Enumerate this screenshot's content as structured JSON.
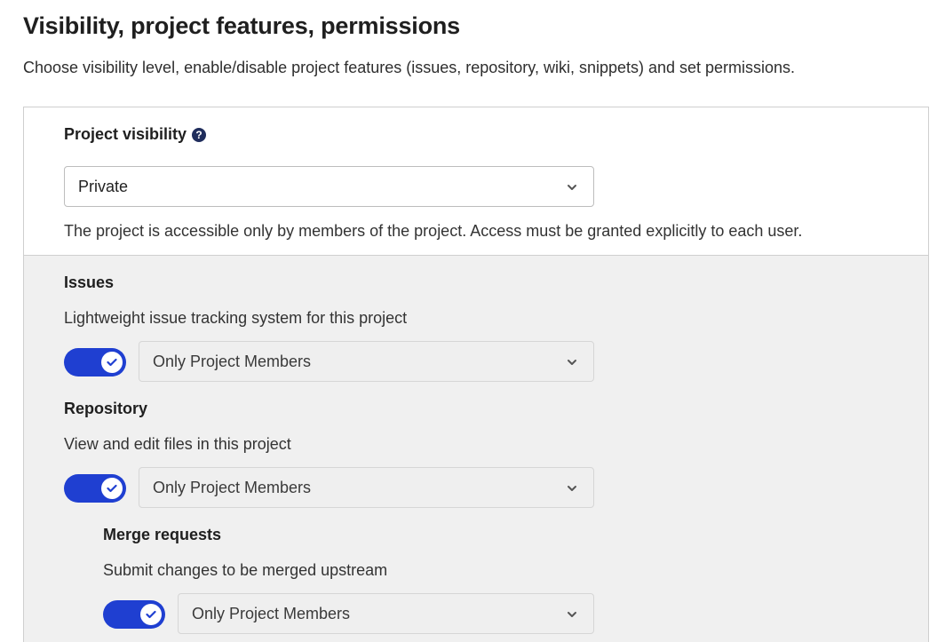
{
  "header": {
    "title": "Visibility, project features, permissions",
    "description": "Choose visibility level, enable/disable project features (issues, repository, wiki, snippets) and set permissions."
  },
  "visibility": {
    "label": "Project visibility",
    "help_icon": "question-circle-icon",
    "help_glyph": "?",
    "selected": "Private",
    "help_text": "The project is accessible only by members of the project. Access must be granted explicitly to each user."
  },
  "features": [
    {
      "name": "Issues",
      "description": "Lightweight issue tracking system for this project",
      "enabled": true,
      "access_level": "Only Project Members"
    },
    {
      "name": "Repository",
      "description": "View and edit files in this project",
      "enabled": true,
      "access_level": "Only Project Members"
    },
    {
      "name": "Merge requests",
      "description": "Submit changes to be merged upstream",
      "enabled": true,
      "access_level": "Only Project Members"
    }
  ],
  "colors": {
    "toggle_on": "#1f3fd1",
    "help_icon": "#1f2d5c",
    "panel_shaded": "#f0f0f0"
  },
  "icons": {
    "select_arrow": "chevron-down-icon",
    "toggle_mark": "check-icon"
  }
}
